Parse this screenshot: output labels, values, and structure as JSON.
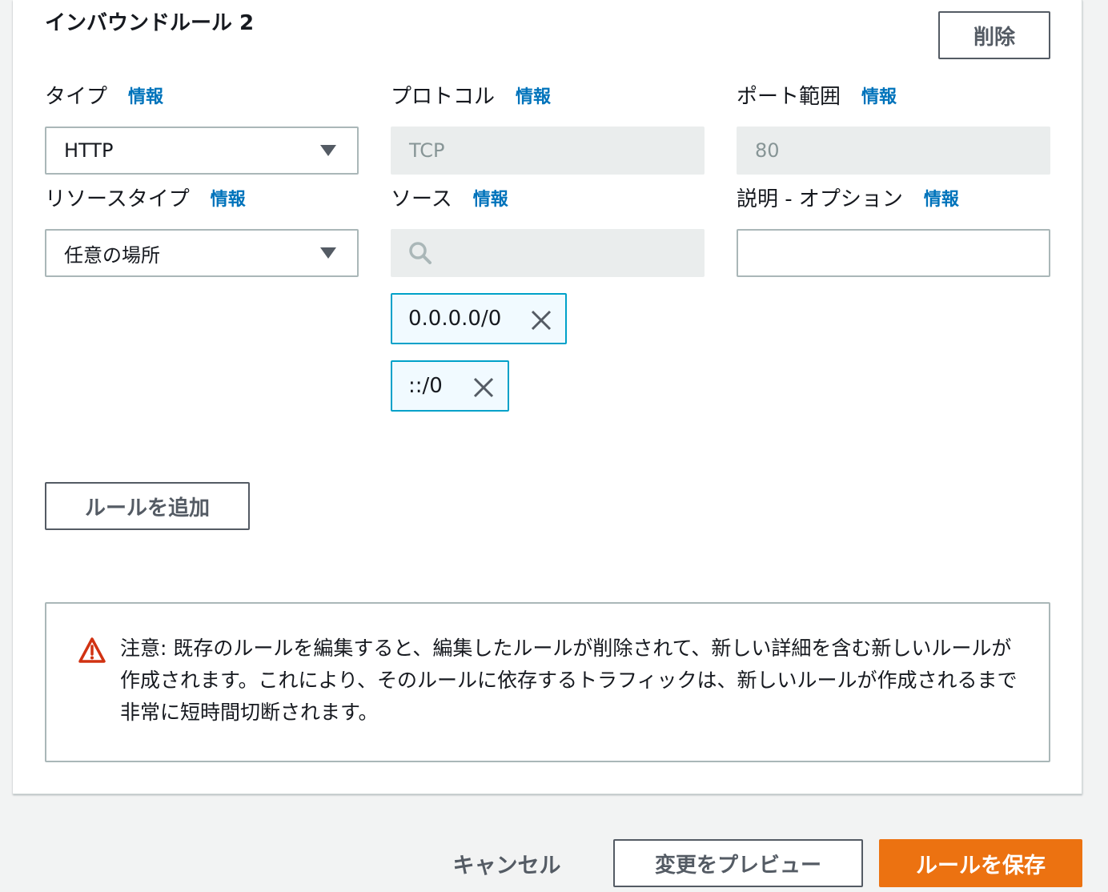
{
  "rule": {
    "title": "インバウンドルール 2",
    "delete_label": "削除",
    "info_label": "情報",
    "type": {
      "label": "タイプ",
      "value": "HTTP"
    },
    "protocol": {
      "label": "プロトコル",
      "value": "TCP"
    },
    "port_range": {
      "label": "ポート範囲",
      "value": "80"
    },
    "resource_type": {
      "label": "リソースタイプ",
      "value": "任意の場所"
    },
    "source": {
      "label": "ソース",
      "search_icon": "search-icon",
      "tokens": [
        "0.0.0.0/0",
        "::/0"
      ]
    },
    "description": {
      "label": "説明 - オプション",
      "value": ""
    }
  },
  "add_rule_label": "ルールを追加",
  "alert": {
    "icon": "warning-icon",
    "text": "注意: 既存のルールを編集すると、編集したルールが削除されて、新しい詳細を含む新しいルールが作成されます。これにより、そのルールに依存するトラフィックは、新しいルールが作成されるまで非常に短時間切断されます。"
  },
  "footer": {
    "cancel_label": "キャンセル",
    "preview_label": "変更をプレビュー",
    "save_label": "ルールを保存"
  },
  "colors": {
    "primary": "#ec7211",
    "link": "#0073bb",
    "token_border": "#00a1c9",
    "warning": "#d13212"
  }
}
